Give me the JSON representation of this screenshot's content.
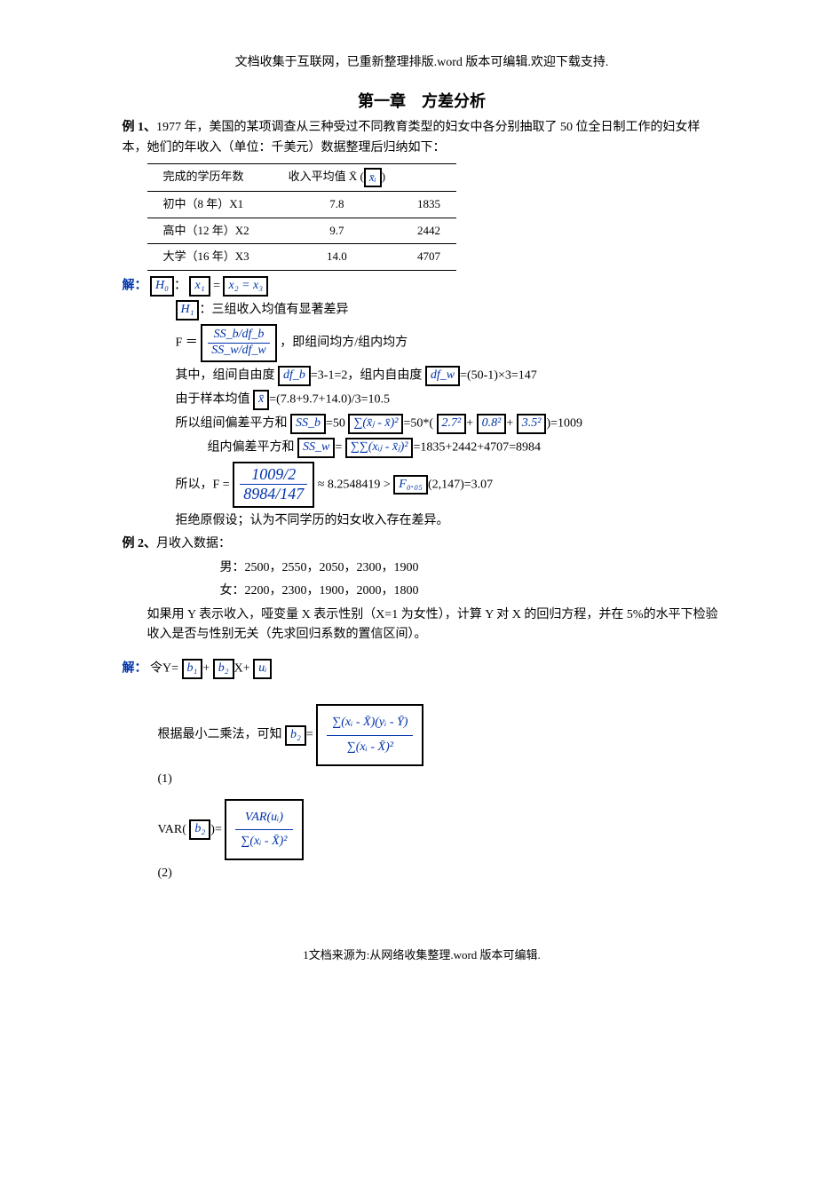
{
  "header_note": "文档收集于互联网，已重新整理排版.word 版本可编辑.欢迎下载支持.",
  "chapter_title": "第一章　方差分析",
  "ex1": {
    "label": "例 1、",
    "text": "1977 年，美国的某项调查从三种受过不同教育类型的妇女中各分别抽取了 50 位全日制工作的妇女样本，她们的年收入（单位：千美元）数据整理后归纳如下："
  },
  "table": {
    "h0": "完成的学历年数",
    "h1_pre": "收入平均值 X̄ (",
    "h1_box": "x̄ᵢ",
    "h1_post": ")",
    "rows": [
      {
        "c0": "初中（8 年）X1",
        "c1": "7.8",
        "c2": "1835"
      },
      {
        "c0": "高中（12 年）X2",
        "c1": "9.7",
        "c2": "2442"
      },
      {
        "c0": "大学（16 年）X3",
        "c1": "14.0",
        "c2": "4707"
      }
    ]
  },
  "sol1": {
    "label": "解：",
    "h0_colon": "：",
    "h0": "H₀",
    "x1": "x₁",
    "eq": " = ",
    "x2x3": "x₂ = x₃",
    "h1": "H₁",
    "h1_text": "：三组收入均值有显著差异",
    "f_eq": "F ＝ ",
    "f_box_num": "SS_b/df_b",
    "f_box_den": "SS_w/df_w",
    "f_text": "，即组间均方/组内均方",
    "line4a": "其中，组间自由度",
    "dfb": "df_b",
    "line4b": "=3-1=2，组内自由度",
    "dfw": "df_w",
    "line4c": "=(50-1)×3=147",
    "line5a": "由于样本均值",
    "xbar": "x̄",
    "line5b": "=(7.8+9.7+14.0)/3=10.5",
    "line6a": "所以组间偏差平方和",
    "ssb": "SS_b",
    "line6b": "=50",
    "sum_sq": "∑(x̄ⱼ - x̄)²",
    "line6c": "=50*(",
    "sq1": "2.7²",
    "line6p": "+",
    "sq2": "0.8²",
    "sq3": "3.5²",
    "line6d": ")=1009",
    "line7a": "组内偏差平方和",
    "ssw": "SS_w",
    "line7eq": "=",
    "sum_double": "∑∑(xᵢⱼ - x̄ⱼ)²",
    "line7b": "=1835+2442+4707=8984",
    "line8a": "所以，F =",
    "fval_num": "1009/2",
    "fval_den": "8984/147",
    "line8b": " ≈ 8.2548419 > ",
    "f005": "F₀.₀₅",
    "line8c": "(2,147)=3.07",
    "line9": "拒绝原假设；认为不同学历的妇女收入存在差异。"
  },
  "ex2": {
    "label": "例 2、",
    "title": "月收入数据：",
    "male": "男：2500，2550，2050，2300，1900",
    "female": "女：2200，2300，1900，2000，1800",
    "desc": "如果用 Y 表示收入，哑变量 X 表示性别（X=1 为女性），计算 Y 对 X 的回归方程，并在 5%的水平下检验收入是否与性别无关（先求回归系数的置信区间）。"
  },
  "sol2": {
    "label": "解：",
    "line1a": "令Y=",
    "b1": "b₁",
    "plus": "+",
    "b2": "b₂",
    "line1b": "X+",
    "ui": "uᵢ",
    "line2a": "根据最小二乘法，可知",
    "line2eq": "=",
    "ols_num": "∑(xᵢ - X̄)(yᵢ - Ȳ)",
    "ols_den": "∑(xᵢ - X̄)²",
    "mark1": "(1)",
    "line3a": "VAR(",
    "line3b": ")=",
    "var_num": "VAR(uᵢ)",
    "var_den": "∑(xᵢ - X̄)²",
    "mark2": "(2)"
  },
  "footer": "1文档来源为:从网络收集整理.word 版本可编辑."
}
